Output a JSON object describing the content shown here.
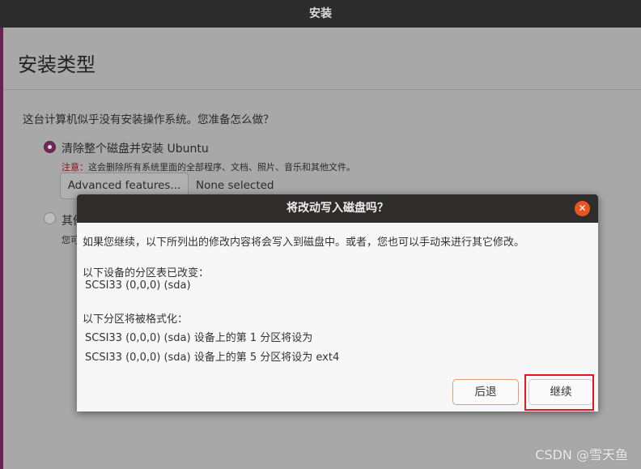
{
  "window": {
    "title": "安装"
  },
  "page": {
    "title": "安装类型",
    "question": "这台计算机似乎没有安装操作系统。您准备怎么做？",
    "option1": {
      "label": "清除整个磁盘并安装 Ubuntu",
      "warning_prefix": "注意：",
      "warning": "这会删除所有系统里面的全部程序、文档、照片、音乐和其他文件。",
      "selected": true
    },
    "advanced_button": "Advanced features...",
    "advanced_value": "None selected",
    "option2": {
      "label": "其他选项",
      "sub": "您可"
    }
  },
  "dialog": {
    "title": "将改动写入磁盘吗？",
    "close_icon": "close-icon",
    "intro": "如果您继续，以下所列出的修改内容将会写入到磁盘中。或者，您也可以手动来进行其它修改。",
    "partition_table_heading": "以下设备的分区表已改变：",
    "partition_table_devices": [
      "SCSI33 (0,0,0) (sda)"
    ],
    "format_heading": "以下分区将被格式化：",
    "format_items": [
      "SCSI33 (0,0,0) (sda) 设备上的第 1 分区将设为",
      "SCSI33 (0,0,0) (sda) 设备上的第 5 分区将设为 ext4"
    ],
    "back_button": "后退",
    "continue_button": "继续"
  },
  "watermark": "CSDN @雪天鱼"
}
